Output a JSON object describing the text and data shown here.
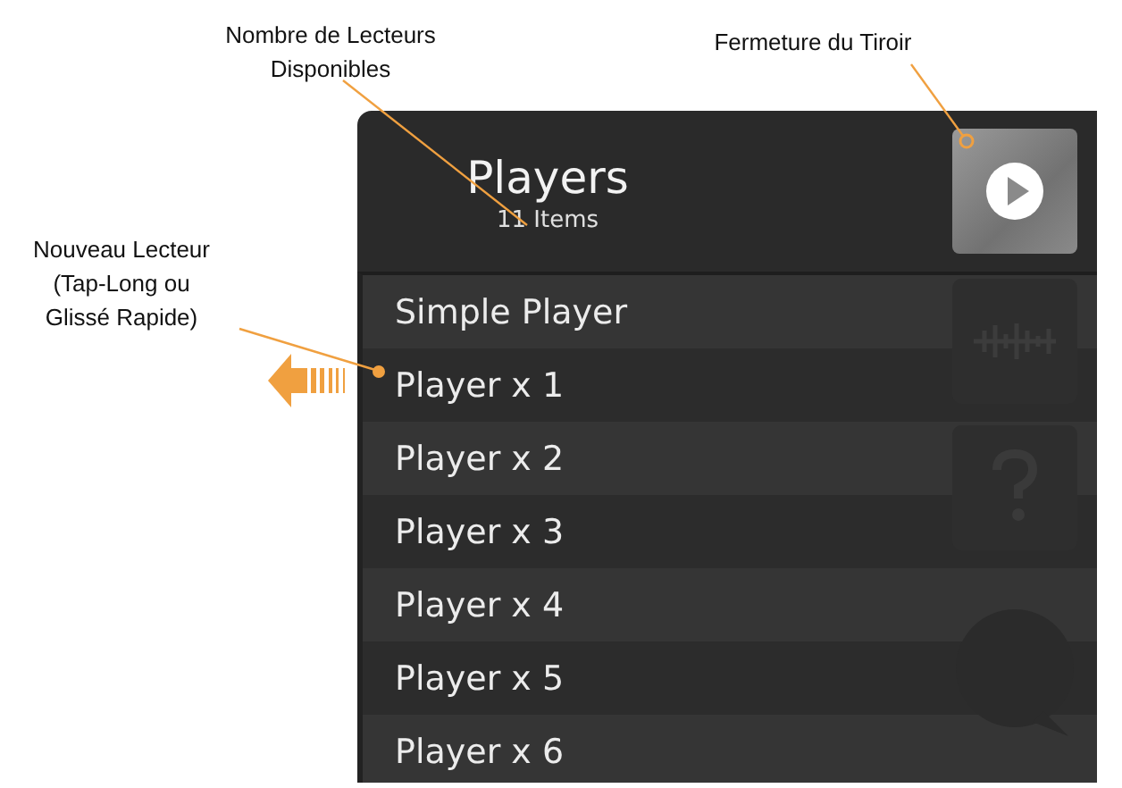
{
  "annotations": [
    {
      "kind": "count",
      "lines": [
        "Nombre de Lecteurs",
        "Disponibles"
      ]
    },
    {
      "kind": "close",
      "lines": [
        "Fermeture du Tiroir"
      ]
    },
    {
      "kind": "new",
      "lines": [
        "Nouveau Lecteur",
        "(Tap-Long ou",
        "Glissé Rapide)"
      ]
    }
  ],
  "header": {
    "title": "Players",
    "count": "11 Items"
  },
  "players": [
    {
      "name": "Simple Player"
    },
    {
      "name": "Player x 1"
    },
    {
      "name": "Player x 2"
    },
    {
      "name": "Player x 3"
    },
    {
      "name": "Player x 4"
    },
    {
      "name": "Player x 5"
    },
    {
      "name": "Player x 6"
    }
  ]
}
